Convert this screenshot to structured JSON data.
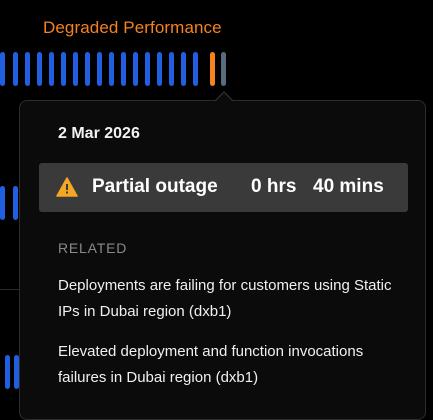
{
  "status": {
    "title": "Degraded Performance",
    "color_degraded": "#f5811f",
    "color_operational": "#1f5fe0",
    "color_no_data": "#5a6b80"
  },
  "tooltip": {
    "date": "2 Mar 2026",
    "outage": {
      "icon": "warning-icon",
      "label": "Partial outage",
      "hours": "0 hrs",
      "minutes": "40 mins"
    },
    "related_heading": "RELATED",
    "incidents": [
      "Deployments are failing for customers using Static IPs in Dubai region (dxb1)",
      "Elevated deployment and function invocations failures in Dubai region (dxb1)"
    ]
  }
}
